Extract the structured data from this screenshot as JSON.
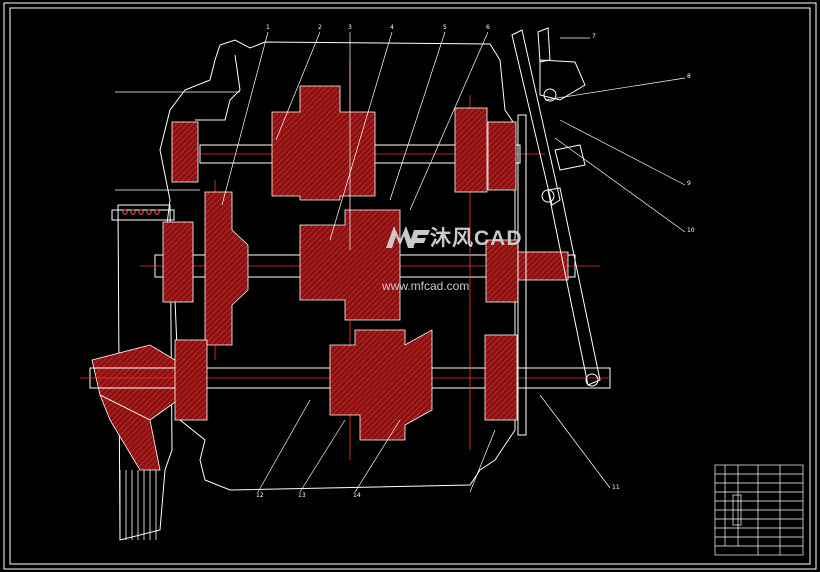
{
  "colors": {
    "background": "#000000",
    "frame": "#ffffff",
    "outline": "#ffffff",
    "section_fill": "#8b1010",
    "hatch": "#d23a3a",
    "centerline": "#ff3030",
    "leader": "#ffffff",
    "watermark": "#c9c9c9"
  },
  "watermark": {
    "brand": "沐风CAD",
    "url": "www.mfcad.com",
    "logo_icon": "mf-logo-icon"
  },
  "callouts": [
    "1",
    "2",
    "3",
    "4",
    "5",
    "6",
    "7",
    "8",
    "9",
    "10",
    "11",
    "12",
    "13",
    "14"
  ],
  "title_block": {
    "rows": 10,
    "columns": 5
  }
}
